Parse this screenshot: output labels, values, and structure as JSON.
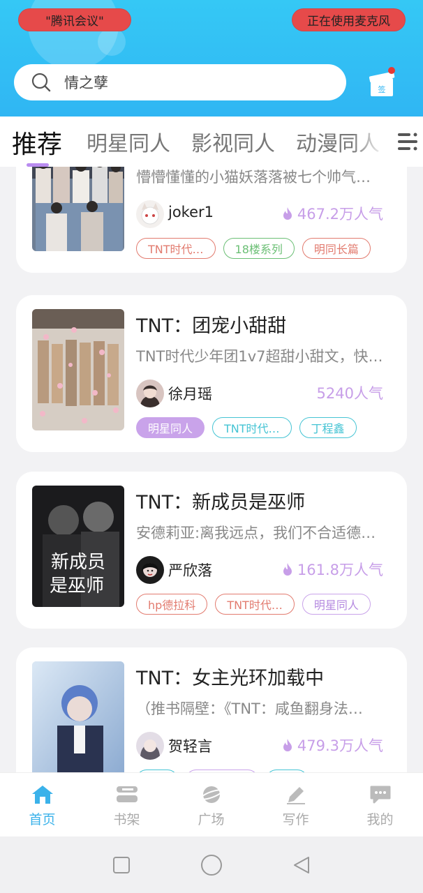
{
  "header": {
    "left_pill": "\"腾讯会议\"",
    "right_pill": "正在使用麦克风",
    "search_placeholder": "情之孽",
    "checkin_label": "签"
  },
  "tabs": [
    {
      "label": "推荐",
      "active": true
    },
    {
      "label": "明星同人",
      "active": false
    },
    {
      "label": "影视同人",
      "active": false
    },
    {
      "label": "动漫同人",
      "active": false
    }
  ],
  "books": [
    {
      "title": "",
      "desc": "懵懵懂懂的小猫妖落落被七个帅气…",
      "author": "joker1",
      "popularity": "467.2万人气",
      "hot": true,
      "tags": [
        {
          "label": "TNT时代…",
          "style": "red"
        },
        {
          "label": "18楼系列",
          "style": "green"
        },
        {
          "label": "明同长篇",
          "style": "red"
        }
      ]
    },
    {
      "title": "TNT：团宠小甜甜",
      "desc": "TNT时代少年团1v7超甜小甜文，快…",
      "author": "徐月瑶",
      "popularity": "5240人气",
      "hot": false,
      "tags": [
        {
          "label": "明星同人",
          "style": "purple-fill"
        },
        {
          "label": "TNT时代…",
          "style": "cyan"
        },
        {
          "label": "丁程鑫",
          "style": "cyan"
        }
      ]
    },
    {
      "title": "TNT：新成员是巫师",
      "desc": "安德莉亚:离我远点，我们不合适德…",
      "author": "严欣落",
      "popularity": "161.8万人气",
      "hot": true,
      "cover_text_1": "新成员",
      "cover_text_2": "是巫师",
      "tags": [
        {
          "label": "hp德拉科",
          "style": "red"
        },
        {
          "label": "TNT时代…",
          "style": "red"
        },
        {
          "label": "明星同人",
          "style": "purple"
        }
      ]
    },
    {
      "title": "TNT：女主光环加载中",
      "desc": "（推书隔壁：《TNT：咸鱼翻身法…",
      "author": "贺轻言",
      "popularity": "479.3万人气",
      "hot": true,
      "tags": []
    }
  ],
  "bottom_nav": [
    {
      "label": "首页",
      "icon": "home-icon",
      "active": true
    },
    {
      "label": "书架",
      "icon": "bookshelf-icon",
      "active": false
    },
    {
      "label": "广场",
      "icon": "planet-icon",
      "active": false
    },
    {
      "label": "写作",
      "icon": "pen-icon",
      "active": false
    },
    {
      "label": "我的",
      "icon": "chat-bubble-icon",
      "active": false
    }
  ],
  "colors": {
    "header": "#35c8f5",
    "accent_purple": "#c79ee8",
    "active_nav": "#3bb2ea",
    "pill_red": "#e64a4a"
  }
}
